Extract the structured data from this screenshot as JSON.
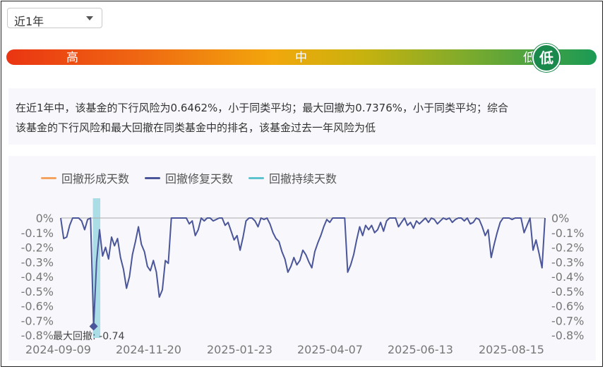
{
  "period_select": {
    "value": "近1年"
  },
  "risk_bar": {
    "high": "高",
    "mid": "中",
    "low": "低",
    "current": "低"
  },
  "summary": {
    "line1": "在近1年中，该基金的下行风险为0.6462%，小于同类平均；最大回撤为0.7376%，小于同类平均；综合",
    "line2": "该基金的下行风险和最大回撤在同类基金中的排名，该基金过去一年风险为低"
  },
  "colors": {
    "formation": "#f4a460",
    "recovery": "#4a5699",
    "duration": "#5cc3cf"
  },
  "chart_data": {
    "type": "area",
    "legend": [
      {
        "name": "回撤形成天数",
        "color": "#f4a460"
      },
      {
        "name": "回撤修复天数",
        "color": "#4a5699"
      },
      {
        "name": "回撤持续天数",
        "color": "#5cc3cf"
      }
    ],
    "x_ticks": [
      "2024-09-09",
      "2024-11-20",
      "2025-01-23",
      "2025-04-07",
      "2025-06-13",
      "2025-08-15"
    ],
    "y_ticks": [
      "0%",
      "-0.1%",
      "-0.2%",
      "-0.3%",
      "-0.4%",
      "-0.5%",
      "-0.6%",
      "-0.7%",
      "-0.8%"
    ],
    "ylim": [
      -0.8,
      0
    ],
    "max_drawdown_label": "最大回撤: -0.74",
    "max_drawdown_value": -0.74,
    "drawdown": [
      0,
      -0.14,
      -0.13,
      -0.05,
      0,
      0,
      0,
      -0.02,
      -0.08,
      -0.01,
      0,
      -0.74,
      -0.3,
      -0.08,
      -0.26,
      -0.2,
      -0.28,
      -0.13,
      -0.19,
      -0.14,
      -0.27,
      -0.35,
      -0.48,
      -0.4,
      -0.25,
      -0.16,
      -0.06,
      -0.18,
      -0.23,
      -0.33,
      -0.36,
      -0.29,
      -0.37,
      -0.54,
      -0.49,
      -0.29,
      -0.31,
      0,
      0,
      0,
      0,
      0,
      0,
      -0.04,
      -0.02,
      -0.12,
      -0.08,
      0,
      -0.02,
      0,
      0,
      -0.02,
      -0.01,
      0,
      0,
      -0.05,
      -0.03,
      -0.09,
      -0.15,
      -0.12,
      -0.22,
      -0.13,
      -0.02,
      0,
      0,
      -0.02,
      -0.06,
      0,
      -0.01,
      0,
      -0.04,
      -0.1,
      -0.14,
      -0.16,
      -0.23,
      -0.28,
      -0.37,
      -0.33,
      -0.27,
      -0.32,
      -0.29,
      -0.22,
      -0.25,
      -0.3,
      -0.34,
      -0.23,
      -0.17,
      -0.12,
      -0.06,
      -0.01,
      -0.03,
      0,
      0,
      0,
      0,
      0,
      -0.37,
      -0.32,
      -0.25,
      -0.15,
      -0.06,
      -0.12,
      -0.05,
      -0.08,
      -0.05,
      -0.1,
      -0.08,
      -0.03,
      -0.09,
      -0.02,
      0,
      0,
      0,
      -0.06,
      -0.03,
      0,
      -0.05,
      -0.03,
      -0.07,
      -0.02,
      -0.04,
      -0.02,
      0,
      -0.03,
      0,
      -0.01,
      -0.04,
      -0.02,
      0,
      -0.01,
      0,
      -0.03,
      -0.01,
      0,
      0,
      -0.02,
      0,
      -0.04,
      -0.03,
      0,
      -0.01,
      -0.06,
      -0.12,
      -0.08,
      -0.27,
      -0.18,
      -0.1,
      -0.03,
      0,
      0,
      0,
      -0.01,
      0,
      0,
      0,
      -0.1,
      -0.05,
      0,
      -0.22,
      -0.15,
      -0.24,
      -0.34,
      0
    ],
    "max_drawdown_index": 11,
    "duration_band": [
      11,
      13
    ]
  }
}
